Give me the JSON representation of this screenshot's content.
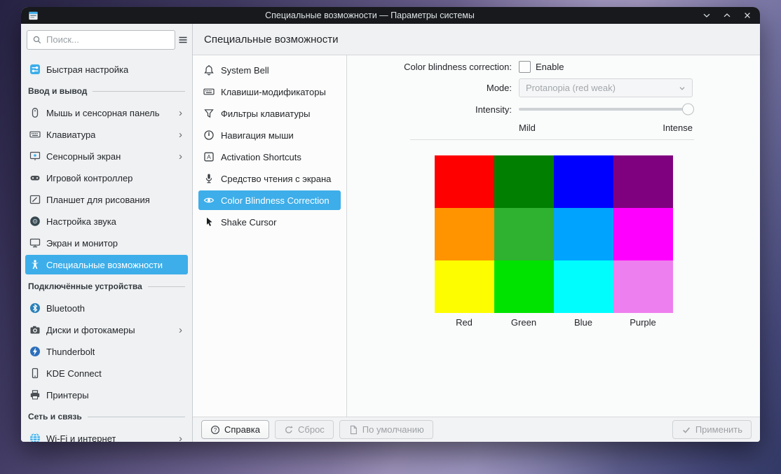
{
  "titlebar": {
    "title": "Специальные возможности — Параметры системы",
    "app_icon": "system-settings-app-icon",
    "controls": [
      "window-minimize-icon",
      "window-maximize-icon",
      "window-close-icon"
    ]
  },
  "sidebar": {
    "search": {
      "placeholder": "Поиск...",
      "icon": "search-icon"
    },
    "menu_icon": "hamburger-menu-icon",
    "items": [
      {
        "label": "Быстрая настройка",
        "icon": "quick-settings-icon"
      },
      {
        "section": "Ввод и вывод"
      },
      {
        "label": "Мышь и сенсорная панель",
        "icon": "mouse-icon",
        "chevron": true
      },
      {
        "label": "Клавиатура",
        "icon": "keyboard-icon",
        "chevron": true
      },
      {
        "label": "Сенсорный экран",
        "icon": "touchscreen-icon",
        "chevron": true
      },
      {
        "label": "Игровой контроллер",
        "icon": "gamepad-icon"
      },
      {
        "label": "Планшет для рисования",
        "icon": "drawing-tablet-icon"
      },
      {
        "label": "Настройка звука",
        "icon": "audio-volume-icon"
      },
      {
        "label": "Экран и монитор",
        "icon": "display-monitor-icon"
      },
      {
        "label": "Специальные возможности",
        "icon": "accessibility-icon",
        "selected": true
      },
      {
        "section": "Подключённые устройства"
      },
      {
        "label": "Bluetooth",
        "icon": "bluetooth-icon"
      },
      {
        "label": "Диски и фотокамеры",
        "icon": "camera-disks-icon",
        "chevron": true
      },
      {
        "label": "Thunderbolt",
        "icon": "thunderbolt-icon"
      },
      {
        "label": "KDE Connect",
        "icon": "kde-connect-icon"
      },
      {
        "label": "Принтеры",
        "icon": "printer-icon"
      },
      {
        "section": "Сеть и связь"
      },
      {
        "label": "Wi-Fi и интернет",
        "icon": "wifi-internet-icon",
        "chevron": true
      }
    ]
  },
  "page": {
    "title": "Специальные возможности",
    "subnav": [
      {
        "label": "System Bell",
        "icon": "bell-icon"
      },
      {
        "label": "Клавиши-модификаторы",
        "icon": "modifier-keys-icon"
      },
      {
        "label": "Фильтры клавиатуры",
        "icon": "keyboard-filter-icon"
      },
      {
        "label": "Навигация мыши",
        "icon": "mouse-navigation-icon"
      },
      {
        "label": "Activation Shortcuts",
        "icon": "activation-shortcuts-icon"
      },
      {
        "label": "Средство чтения с экрана",
        "icon": "screen-reader-icon"
      },
      {
        "label": "Color Blindness Correction",
        "icon": "eye-icon",
        "selected": true
      },
      {
        "label": "Shake Cursor",
        "icon": "shake-cursor-icon"
      }
    ]
  },
  "content": {
    "correction_label": "Color blindness correction:",
    "enable": {
      "label": "Enable",
      "checked": false
    },
    "mode": {
      "label": "Mode:",
      "value": "Protanopia (red weak)",
      "disabled": true,
      "dropdown_icon": "chevron-down-icon"
    },
    "intensity": {
      "label": "Intensity:",
      "min_label": "Mild",
      "max_label": "Intense",
      "value_percent": 100,
      "disabled": true
    },
    "palette": {
      "column_labels": [
        "Red",
        "Green",
        "Blue",
        "Purple"
      ],
      "rows": [
        [
          "#fe0000",
          "#017f01",
          "#0000fe",
          "#7f017f"
        ],
        [
          "#ff9300",
          "#2fb22f",
          "#00a3fe",
          "#fe00fe"
        ],
        [
          "#fdfd00",
          "#00e300",
          "#00fdfe",
          "#ee7fee"
        ]
      ]
    }
  },
  "footer": {
    "help": {
      "label": "Справка",
      "icon": "help-icon",
      "enabled": true
    },
    "reset": {
      "label": "Сброс",
      "icon": "reset-icon",
      "enabled": false
    },
    "defaults": {
      "label": "По умолчанию",
      "icon": "document-icon",
      "enabled": false
    },
    "apply": {
      "label": "Применить",
      "icon": "check-icon",
      "enabled": false
    }
  }
}
